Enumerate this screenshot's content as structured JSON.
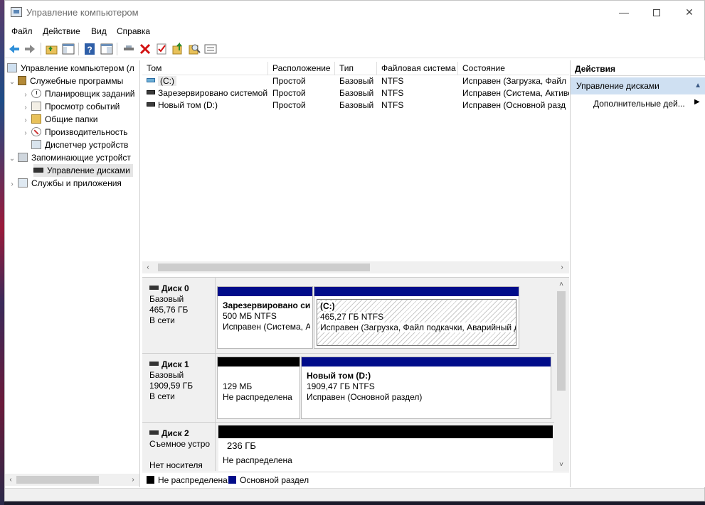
{
  "window": {
    "title": "Управление компьютером",
    "controls": {
      "minimize": "—",
      "close": "✕"
    }
  },
  "menu": [
    "Файл",
    "Действие",
    "Вид",
    "Справка"
  ],
  "toolbar_icons": [
    "back-icon",
    "forward-icon",
    "up-folder-icon",
    "show-hide-tree-icon",
    "help-icon",
    "properties-view-icon",
    "connect-icon",
    "delete-icon",
    "check-icon",
    "export-icon",
    "search-icon",
    "list-icon"
  ],
  "tree": {
    "root": "Управление компьютером (л",
    "system_tools": "Служебные программы",
    "task_scheduler": "Планировщик заданий",
    "event_viewer": "Просмотр событий",
    "shared_folders": "Общие папки",
    "performance": "Производительность",
    "device_manager": "Диспетчер устройств",
    "storage": "Запоминающие устройст",
    "disk_management": "Управление дисками",
    "services_apps": "Службы и приложения"
  },
  "volume_list": {
    "columns": [
      "Том",
      "Расположение",
      "Тип",
      "Файловая система",
      "Состояние"
    ],
    "rows": [
      {
        "volume": "(C:)",
        "layout": "Простой",
        "type": "Базовый",
        "fs": "NTFS",
        "status": "Исправен (Загрузка, Файл"
      },
      {
        "volume": "Зарезервировано системой",
        "layout": "Простой",
        "type": "Базовый",
        "fs": "NTFS",
        "status": "Исправен (Система, Активе"
      },
      {
        "volume": "Новый том (D:)",
        "layout": "Простой",
        "type": "Базовый",
        "fs": "NTFS",
        "status": "Исправен (Основной разд"
      }
    ]
  },
  "disks": [
    {
      "name": "Диск 0",
      "type": "Базовый",
      "size": "465,76 ГБ",
      "state": "В сети",
      "partitions": [
        {
          "name": "Зарезервировано си",
          "size": "500 МБ NTFS",
          "status": "Исправен (Система, А"
        },
        {
          "name": "(C:)",
          "size": "465,27 ГБ NTFS",
          "status": "Исправен (Загрузка, Файл подкачки, Аварийный д"
        }
      ]
    },
    {
      "name": "Диск 1",
      "type": "Базовый",
      "size": "1909,59 ГБ",
      "state": "В сети",
      "partitions": [
        {
          "name": "",
          "size": "129 МБ",
          "status": "Не распределена"
        },
        {
          "name": "Новый том  (D:)",
          "size": "1909,47 ГБ NTFS",
          "status": "Исправен (Основной раздел)"
        }
      ]
    },
    {
      "name": "Диск 2",
      "type": "Съемное устро",
      "state": "Нет носителя",
      "partitions": [
        {
          "size": "236 ГБ",
          "status": "Не распределена"
        }
      ]
    }
  ],
  "legend": {
    "unallocated": "Не распределена",
    "primary": "Основной раздел",
    "colors": {
      "unallocated": "#000000",
      "primary": "#010c8a"
    }
  },
  "actions": {
    "header": "Действия",
    "section": "Управление дисками",
    "more": "Дополнительные дей..."
  }
}
